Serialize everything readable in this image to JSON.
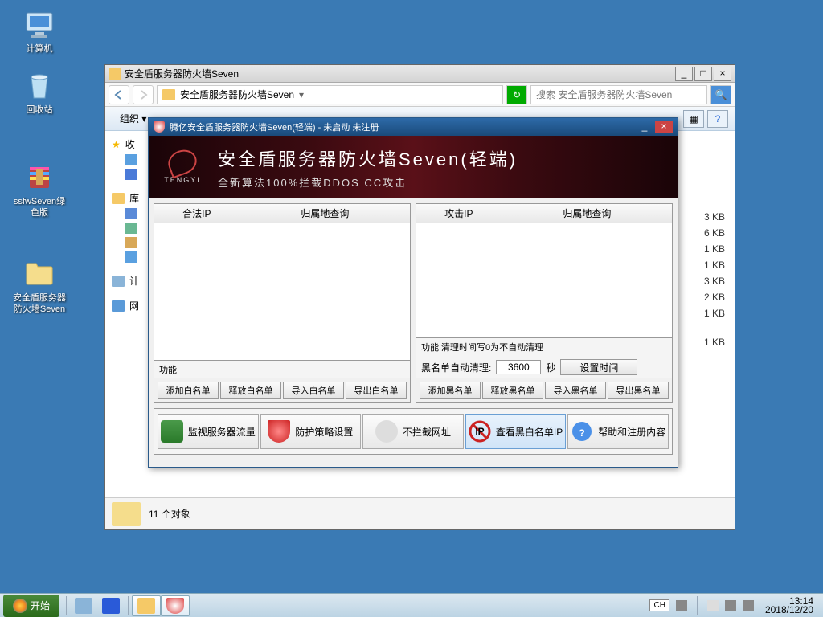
{
  "desktop": {
    "icons": [
      {
        "name": "computer",
        "label": "计算机"
      },
      {
        "name": "recycle",
        "label": "回收站"
      },
      {
        "name": "ssfw",
        "label": "ssfwSeven绿色版"
      },
      {
        "name": "fwfolder",
        "label": "安全盾服务器防火墙Seven"
      }
    ]
  },
  "explorer": {
    "title": "安全盾服务器防火墙Seven",
    "path": "安全盾服务器防火墙Seven",
    "path_dropdown": "▾",
    "search_placeholder": "搜索 安全盾服务器防火墙Seven",
    "toolbar": {
      "organize": "组织 ▾"
    },
    "sidebar": {
      "fav": "收",
      "lib": "库",
      "computer": "计",
      "network": "网"
    },
    "filesizes": [
      "3 KB",
      "6 KB",
      "1 KB",
      "1 KB",
      "3 KB",
      "2 KB",
      "1 KB",
      "1 KB"
    ],
    "status": "11 个对象"
  },
  "fw": {
    "title": "腾亿安全盾服务器防火墙Seven(轻端) - 未启动 未注册",
    "banner": {
      "logo": "TENGYI",
      "big": "安全盾服务器防火墙Seven(轻端)",
      "sub": "全新算法100%拦截DDOS CC攻击"
    },
    "left": {
      "cols": [
        "合法IP",
        "归属地查询"
      ],
      "func_label": "功能",
      "buttons": [
        "添加白名单",
        "释放白名单",
        "导入白名单",
        "导出白名单"
      ]
    },
    "right": {
      "cols": [
        "攻击IP",
        "归属地查询"
      ],
      "func_label": "功能 清理时间写0为不自动清理",
      "clean_label": "黑名单自动清理:",
      "clean_value": "3600",
      "clean_unit": "秒",
      "clean_btn": "设置时间",
      "buttons": [
        "添加黑名单",
        "释放黑名单",
        "导入黑名单",
        "导出黑名单"
      ]
    },
    "bottom": [
      "监视服务器流量",
      "防护策略设置",
      "不拦截网址",
      "查看黑白名单IP",
      "帮助和注册内容"
    ]
  },
  "taskbar": {
    "start": "开始",
    "ime": "CH",
    "time": "13:14",
    "date": "2018/12/20"
  }
}
